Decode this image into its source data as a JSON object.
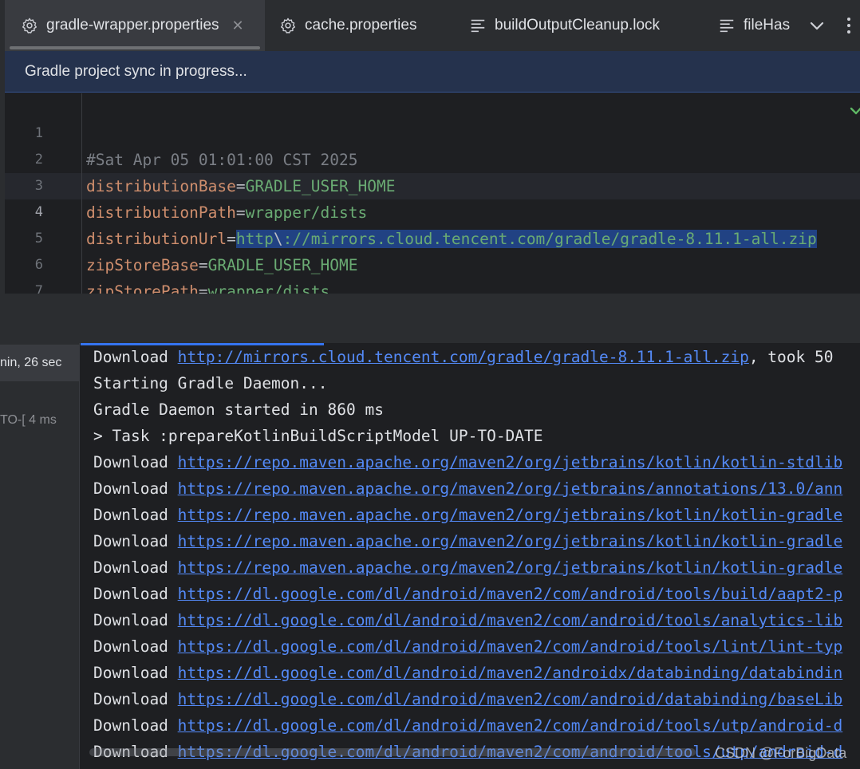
{
  "tabs": [
    {
      "label": "gradle-wrapper.properties",
      "icon": "gear-icon",
      "active": true,
      "close_glyph": "✕"
    },
    {
      "label": "cache.properties",
      "icon": "gear-icon"
    },
    {
      "label": "buildOutputCleanup.lock",
      "icon": "text-file-icon"
    },
    {
      "label": "fileHas",
      "icon": "text-file-icon"
    }
  ],
  "banner": {
    "text": "Gradle project sync in progress..."
  },
  "editor": {
    "lines": [
      {
        "n": "1",
        "comment": "#Sat Apr 05 01:01:00 CST 2025"
      },
      {
        "n": "2",
        "key": "distributionBase",
        "eq": "=",
        "value": "GRADLE_USER_HOME"
      },
      {
        "n": "3",
        "key": "distributionPath",
        "eq": "=",
        "value": "wrapper/dists"
      },
      {
        "n": "4",
        "key": "distributionUrl",
        "eq": "=",
        "value_a": "http",
        "value_b": "\\",
        "value_c": "://mirrors.cloud.tencent.com/gradle/gradle-8.11.1-all.zip"
      },
      {
        "n": "5",
        "key": "zipStoreBase",
        "eq": "=",
        "value": "GRADLE_USER_HOME"
      },
      {
        "n": "6",
        "key": "zipStorePath",
        "eq": "=",
        "value": "wrapper/dists"
      },
      {
        "n": "7"
      }
    ]
  },
  "build_tree": {
    "items": [
      {
        "text": "nin, 26 sec"
      },
      {
        "text": "TO-[",
        "time": "4 ms"
      }
    ]
  },
  "console": {
    "lines": [
      {
        "prefix": "Download ",
        "link": "http://mirrors.cloud.tencent.com/gradle/gradle-8.11.1-all.zip",
        "suffix": ", took 50"
      },
      {
        "text": "Starting Gradle Daemon..."
      },
      {
        "text": "Gradle Daemon started in 860 ms"
      },
      {
        "text": "> Task :prepareKotlinBuildScriptModel UP-TO-DATE"
      },
      {
        "prefix": "Download ",
        "link": "https://repo.maven.apache.org/maven2/org/jetbrains/kotlin/kotlin-stdlib"
      },
      {
        "prefix": "Download ",
        "link": "https://repo.maven.apache.org/maven2/org/jetbrains/annotations/13.0/ann"
      },
      {
        "prefix": "Download ",
        "link": "https://repo.maven.apache.org/maven2/org/jetbrains/kotlin/kotlin-gradle"
      },
      {
        "prefix": "Download ",
        "link": "https://repo.maven.apache.org/maven2/org/jetbrains/kotlin/kotlin-gradle"
      },
      {
        "prefix": "Download ",
        "link": "https://repo.maven.apache.org/maven2/org/jetbrains/kotlin/kotlin-gradle"
      },
      {
        "prefix": "Download ",
        "link": "https://dl.google.com/dl/android/maven2/com/android/tools/build/aapt2-p"
      },
      {
        "prefix": "Download ",
        "link": "https://dl.google.com/dl/android/maven2/com/android/tools/analytics-lib"
      },
      {
        "prefix": "Download ",
        "link": "https://dl.google.com/dl/android/maven2/com/android/tools/lint/lint-typ"
      },
      {
        "prefix": "Download ",
        "link": "https://dl.google.com/dl/android/maven2/androidx/databinding/databindin"
      },
      {
        "prefix": "Download ",
        "link": "https://dl.google.com/dl/android/maven2/com/android/databinding/baseLib"
      },
      {
        "prefix": "Download ",
        "link": "https://dl.google.com/dl/android/maven2/com/android/tools/utp/android-d"
      },
      {
        "prefix": "Download ",
        "link": "https://dl.google.com/dl/android/maven2/com/android/tools/utp/android-d"
      }
    ]
  },
  "watermark": "CSDN @ForBigData",
  "colors": {
    "accent": "#3574f0",
    "link": "#548af7",
    "property_key": "#cf8e6d",
    "property_value": "#6aab73",
    "comment": "#7a7e85",
    "selection": "#214283",
    "banner_bg": "#25324d",
    "ok_check": "#5fb865"
  }
}
